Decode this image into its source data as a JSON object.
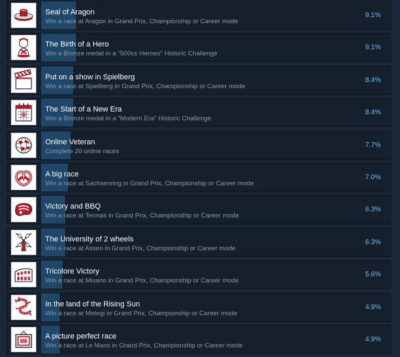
{
  "colors": {
    "background": "#1b2838",
    "row_background": "#16202d",
    "progress_fill": "#1f4a6e",
    "title": "#ffffff",
    "description": "#8f98a0",
    "percent": "#66c0f4",
    "icon_accent": "#c0182a"
  },
  "achievements": [
    {
      "title": "Seal of Aragon",
      "description": "Win a race at Aragon in Grand Prix, Championship or Career mode",
      "percent": "9.1%",
      "percent_value": 9.1,
      "icon": "seal-icon"
    },
    {
      "title": "The Birth of a Hero",
      "description": "Win a Bronze medal in a \"500cc Heroes\" Historic Challenge",
      "percent": "9.1%",
      "percent_value": 9.1,
      "icon": "baby-icon"
    },
    {
      "title": "Put on a show in Spielberg",
      "description": "Win a race at Spielberg in Grand Prix, Championship or Career mode",
      "percent": "8.4%",
      "percent_value": 8.4,
      "icon": "clapperboard-icon"
    },
    {
      "title": "The Start of a New Era",
      "description": "Win a Bronze medal in a \"Modern Era\" Historic Challenge",
      "percent": "8.4%",
      "percent_value": 8.4,
      "icon": "calendar-icon"
    },
    {
      "title": "Online Veteran",
      "description": "Complete 20 online races",
      "percent": "7.7%",
      "percent_value": 7.7,
      "icon": "globe-icon"
    },
    {
      "title": "A big race",
      "description": "Win a race at Sachsenring in Grand Prix, Championship or Career mode",
      "percent": "7.0%",
      "percent_value": 7.0,
      "icon": "pretzel-icon"
    },
    {
      "title": "Victory and BBQ",
      "description": "Win a race at Termas in Grand Prix, Championship or Career mode",
      "percent": "6.3%",
      "percent_value": 6.3,
      "icon": "steak-icon"
    },
    {
      "title": "The University of 2 wheels",
      "description": "Win a race at Assen in Grand Prix, Championship or Career mode",
      "percent": "6.3%",
      "percent_value": 6.3,
      "icon": "windmill-icon"
    },
    {
      "title": "Tricolore Victory",
      "description": "Win a race at Misano in Grand Prix, Championship or Career mode",
      "percent": "5.6%",
      "percent_value": 5.6,
      "icon": "colosseum-icon"
    },
    {
      "title": "In the land of the Rising Sun",
      "description": "Win a race at Motegi in Grand Prix, Championship or Career mode",
      "percent": "4.9%",
      "percent_value": 4.9,
      "icon": "dragon-icon"
    },
    {
      "title": "A picture perfect race",
      "description": "Win a race at Le Mans in Grand Prix, Championship or Career mode",
      "percent": "4.9%",
      "percent_value": 4.9,
      "icon": "picture-frame-icon"
    }
  ]
}
